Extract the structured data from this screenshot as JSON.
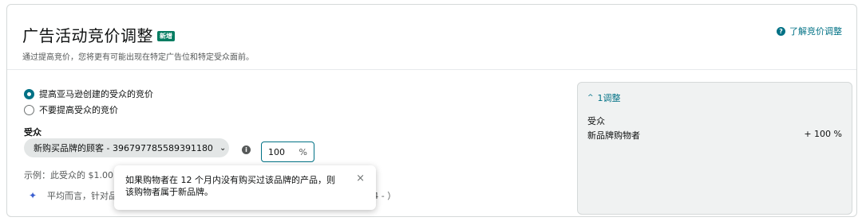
{
  "header": {
    "title": "广告活动竞价调整",
    "badge": "新增",
    "subtitle": "通过提高竞价，您将更有可能出现在特定广告位和特定受众面前。",
    "learn_link": "了解竞价调整"
  },
  "options": {
    "raise_bid": "提高亚马逊创建的受众的竞价",
    "no_raise": "不要提高受众的竞价",
    "selected": "raise_bid"
  },
  "audience": {
    "label": "受众",
    "selected_value": "新购买品牌的顾客 - 396797785589391180",
    "percent_value": "100",
    "percent_unit": "%"
  },
  "example_text": "示例：此受众的 $1.00",
  "insight_text": "平均而言，针对品                                        TB 订单比未提高竞价的广告主多 2 倍（亚马逊研究，全球，2024 -           ）",
  "tooltip": {
    "text": "如果购物者在 12 个月内没有购买过该品牌的产品，则该购物者属于新品牌。",
    "close": "×"
  },
  "summary": {
    "toggle_label": "1调整",
    "audience_label": "受众",
    "row_label": "新品牌购物者",
    "row_value": "+ 100 %"
  },
  "colors": {
    "accent": "#007185",
    "badge": "#067d62",
    "summary_bg": "#f0f2f2"
  }
}
